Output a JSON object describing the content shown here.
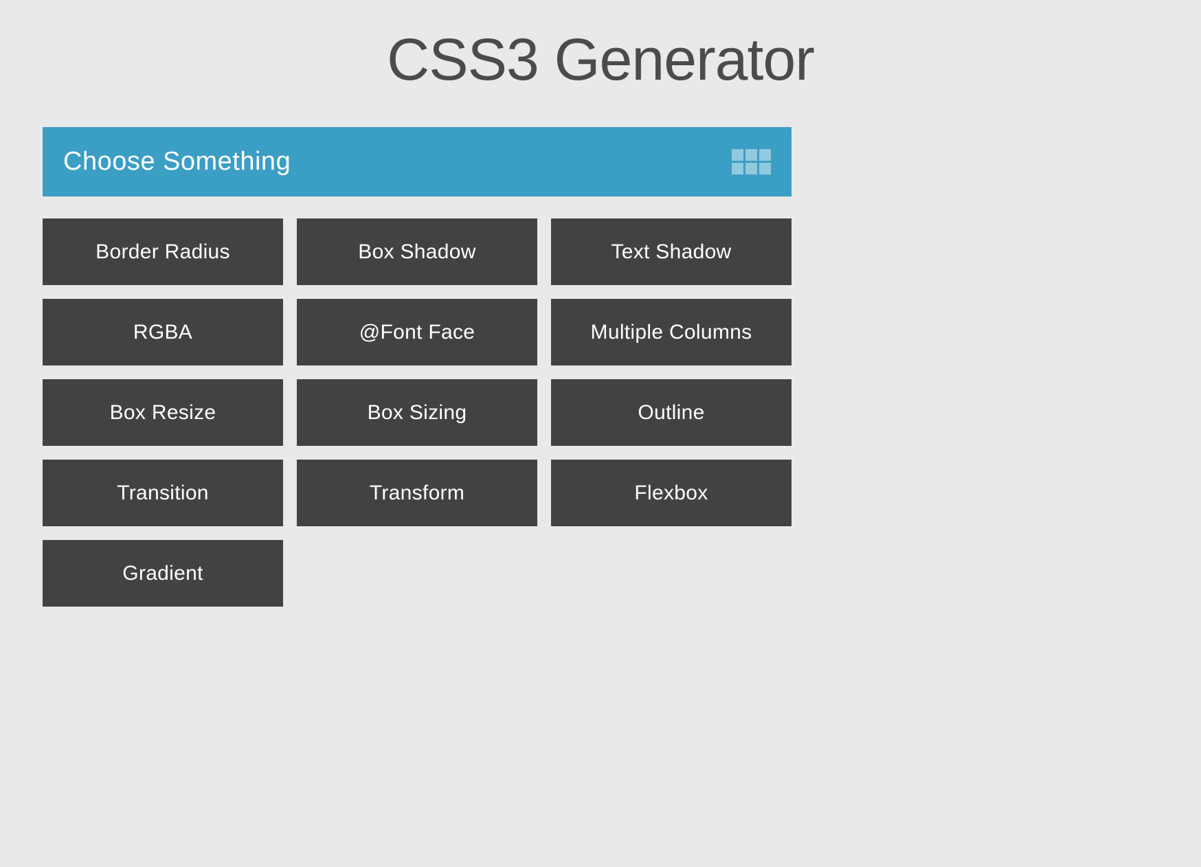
{
  "title": "CSS3 Generator",
  "header": {
    "label": "Choose Something"
  },
  "tiles": [
    {
      "label": "Border Radius"
    },
    {
      "label": "Box Shadow"
    },
    {
      "label": "Text Shadow"
    },
    {
      "label": "RGBA"
    },
    {
      "label": "@Font Face"
    },
    {
      "label": "Multiple Columns"
    },
    {
      "label": "Box Resize"
    },
    {
      "label": "Box Sizing"
    },
    {
      "label": "Outline"
    },
    {
      "label": "Transition"
    },
    {
      "label": "Transform"
    },
    {
      "label": "Flexbox"
    },
    {
      "label": "Gradient"
    }
  ],
  "colors": {
    "background": "#e9e9e9",
    "accent": "#3b9ec4",
    "tile": "#434141",
    "text_light": "#ffffff",
    "text_dark": "#4b4b4b"
  }
}
